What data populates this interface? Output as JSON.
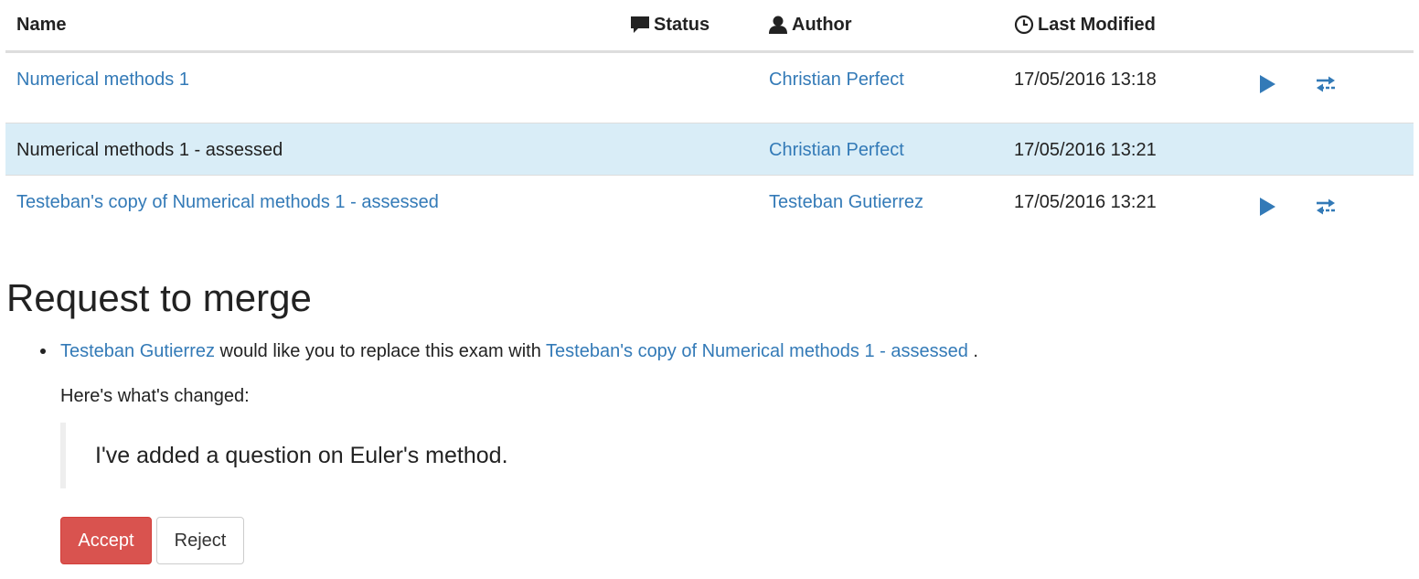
{
  "table": {
    "headers": {
      "name": "Name",
      "status": "Status",
      "author": "Author",
      "last_modified": "Last Modified"
    },
    "rows": [
      {
        "name": "Numerical methods 1",
        "author": "Christian Perfect",
        "last_modified": "17/05/2016 13:18",
        "actions": [
          "play-icon",
          "swap-icon"
        ]
      },
      {
        "name": "Numerical methods 1 - assessed",
        "author": "Christian Perfect",
        "last_modified": "17/05/2016 13:21",
        "highlighted": true,
        "actions": []
      },
      {
        "name": "Testeban's copy of Numerical methods 1 - assessed",
        "author": "Testeban Gutierrez",
        "last_modified": "17/05/2016 13:21",
        "actions": [
          "play-icon",
          "swap-icon"
        ]
      }
    ]
  },
  "merge": {
    "title": "Request to merge",
    "request": {
      "requester": "Testeban Gutierrez",
      "text": " would like you to replace this exam with ",
      "target": "Testeban's copy of Numerical methods 1 - assessed",
      "end": " ."
    },
    "changed_label": "Here's what's changed:",
    "message": "I've added a question on Euler's method.",
    "accept_label": "Accept",
    "reject_label": "Reject"
  },
  "colors": {
    "link": "#337ab7",
    "highlight_row": "#d9edf7",
    "accept": "#d9534f"
  }
}
